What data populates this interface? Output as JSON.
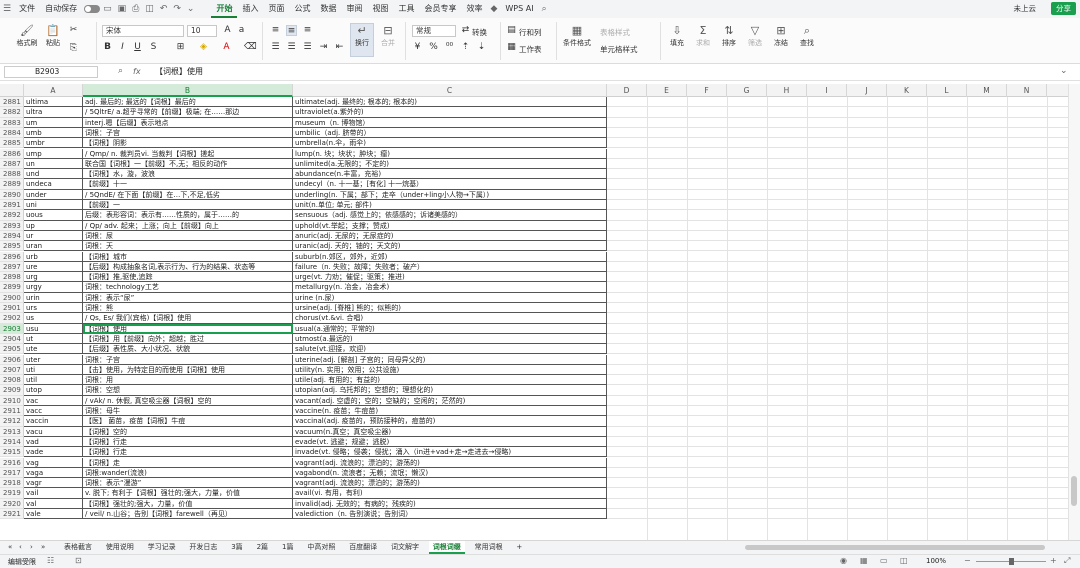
{
  "menu": {
    "file": "文件",
    "autosave": "自动保存",
    "tabs": [
      "开始",
      "插入",
      "页面",
      "公式",
      "数据",
      "审阅",
      "视图",
      "工具",
      "会员专享",
      "效率"
    ],
    "active_tab": "开始",
    "wps_ai": "WPS AI",
    "cloud": "未上云",
    "share": "分享"
  },
  "ribbon": {
    "format_painter": "格式刷",
    "paste": "粘贴",
    "font": "宋体",
    "font_size": "10",
    "wrap": "换行",
    "merge": "合并",
    "number_format": "常规",
    "convert": "转换",
    "rows_cols": "行和列",
    "worksheet": "工作表",
    "cond_format": "条件格式",
    "cell_style": "单元格样式",
    "table_style": "表格样式",
    "fill": "填充",
    "sum": "求和",
    "sort": "排序",
    "filter": "筛选",
    "freeze": "冻结",
    "find": "查找"
  },
  "formula_bar": {
    "cell_ref": "B2903",
    "fx": "fx",
    "content": "【词根】使用"
  },
  "columns": [
    "A",
    "B",
    "C",
    "D",
    "E",
    "F",
    "G",
    "H",
    "I",
    "J",
    "K",
    "L",
    "M",
    "N"
  ],
  "selected_column": "B",
  "selected_row": "2903",
  "rows": [
    [
      "2881",
      "ultima",
      "adj. 最后的; 最远的【词根】最后的",
      "ultimate(adj. 最终的; 根本的; 根本的)"
    ],
    [
      "2882",
      "ultra",
      "/ 5QltrE/  a.超乎寻常的【前缀】极端; 在……那边",
      "ultraviolet(a.紫外的)"
    ],
    [
      "2883",
      "um",
      "interj.嗯【后缀】表示地点",
      "museum（n. 博物馆）"
    ],
    [
      "2884",
      "umb",
      "词根：子宫",
      "umbilic（adj. 脐带的）"
    ],
    [
      "2885",
      "umbr",
      "【词根】阴影",
      "umbrella(n.伞，雨伞)"
    ],
    [
      "2886",
      "ump",
      "/ Qmp/ n. 裁判员vi. 当裁判【词根】搓起",
      "lump(n. 块；块状；肿块；瘤)"
    ],
    [
      "2887",
      "un",
      "联合国【词根】一【前缀】不,无；相反的动作",
      "unlimited(a.无限的；不定的)"
    ],
    [
      "2888",
      "und",
      "【词根】水，漩，波浪",
      "abundance(n.丰富，充裕)"
    ],
    [
      "2889",
      "undeca",
      "【前缀】十一",
      "undecyl（n. 十一基；[有化] 十一烷基）"
    ],
    [
      "2890",
      "under",
      "/ 5QndE/  在下面【前缀】在…下,不足,低劣",
      "underling(n. 下属；部下；走卒（under+ling小人物→下属）)"
    ],
    [
      "2891",
      "uni",
      "【前缀】一",
      "unit(n.单位; 单元; 部件)"
    ],
    [
      "2892",
      "uous",
      "后缀：表形容词：表示有……性质的，属于……的",
      "sensuous（adj. 感觉上的；依感感的；诉诸美感的）"
    ],
    [
      "2893",
      "up",
      "/ Qp/  adv. 起来；上涨；向上【前缀】向上",
      "uphold(vt.举起；支撑；赞成)"
    ],
    [
      "2894",
      "ur",
      "词根：尿",
      "anuric(adj. 无尿的；无尿症的)"
    ],
    [
      "2895",
      "uran",
      "词根：天",
      "uranic(adj. 天的；铀的；天文的)"
    ],
    [
      "2896",
      "urb",
      "【词根】城市",
      "suburb(n.郊区，郊外，近郊)"
    ],
    [
      "2897",
      "ure",
      "【后缀】构成抽象名词,表示行为、行为的结果、状态等",
      "failure（n. 失败；故障；失败者；破产）"
    ],
    [
      "2898",
      "urg",
      "【词根】推,驱使,追踪",
      "urge(vt. 力劝；催促；驱策；推进)"
    ],
    [
      "2899",
      "urgy",
      "词根：technology工艺",
      "metallurgy(n. 冶金，冶金术)"
    ],
    [
      "2900",
      "urin",
      "词根：表示“尿”",
      "urine (n.尿)"
    ],
    [
      "2901",
      "urs",
      "词根：熊",
      "ursine(adj. [脊椎] 熊的；似熊的)"
    ],
    [
      "2902",
      "us",
      "/ Qs, Es/  我们(宾格)【词根】使用",
      "chorus(vt.&vi. 合唱)"
    ],
    [
      "2903",
      "usu",
      "【词根】使用",
      "usual(a.通常的；平常的)"
    ],
    [
      "2904",
      "ut",
      "【词根】用【前缀】向外；超越；胜过",
      "utmost(a.最远的)"
    ],
    [
      "2905",
      "ute",
      "【后缀】表性质、大小状况、状貌",
      "salute(vt.迎接，欢迎)"
    ],
    [
      "2906",
      "uter",
      "词根：子宫",
      "uterine(adj. [解剖] 子宫的；同母异父的)"
    ],
    [
      "2907",
      "uti",
      "【击】使用，为特定目的而使用【词根】使用",
      "utility(n. 实用；效用；公共设施)"
    ],
    [
      "2908",
      "util",
      "词根：用",
      "utile(adj. 有用的；有益的)"
    ],
    [
      "2909",
      "utop",
      "词根：空想",
      "utopian(adj. 乌托邦的；空想的；理想化的)"
    ],
    [
      "2910",
      "vac",
      "/ vAk/ n. 休假, 真空吸尘器【词根】空的",
      "vacant(adj. 空虚的；空的；空缺的；空闲的；茫然的)"
    ],
    [
      "2911",
      "vacc",
      "词根：母牛",
      "vaccine(n. 疫苗；牛痘苗)"
    ],
    [
      "2912",
      "vaccin",
      "【医】 菌苗，疫苗【词根】牛痘",
      "vaccinal(adj. 疫苗的，预防接种的，痘苗的)"
    ],
    [
      "2913",
      "vacu",
      "【词根】空的",
      "vacuum(n.真空；真空吸尘器)"
    ],
    [
      "2914",
      "vad",
      "【词根】行走",
      "evade(vt. 逃避；规避；逃脱)"
    ],
    [
      "2915",
      "vade",
      "【词根】行走",
      "invade(vt. 侵略；侵袭；侵扰；涌入（in进+vad+走→走进去→侵略)"
    ],
    [
      "2916",
      "vag",
      "【词根】走",
      "vagrant(adj. 流浪的；漂泊的；游荡的)"
    ],
    [
      "2917",
      "vaga",
      "词根:wander(流浪)",
      "vagabond(n. 流浪者；无赖；流氓；懒汉)"
    ],
    [
      "2918",
      "vagr",
      "词根：表示“漫游”",
      "vagrant(adj. 流浪的；漂泊的；游荡的)"
    ],
    [
      "2919",
      "vail",
      "v. 脱下; 有利于【词根】强壮的;强大，力量，价值",
      "avail(vi. 有用，有利)"
    ],
    [
      "2920",
      "val",
      "【词根】强壮的;强大，力量，价值",
      "invalid(adj. 无效的；有病的；残疾的)"
    ],
    [
      "2921",
      "vale",
      "/ veil/  n.山谷；告别【词根】farewell（再见）",
      "valediction（n. 告别演说；告别词）"
    ]
  ],
  "sheet_tabs": [
    "表格截言",
    "使用说明",
    "学习记录",
    "开发日志",
    "3篇",
    "2篇",
    "1篇",
    "中高对照",
    "百度翻译",
    "词文解字",
    "词根词缀",
    "常用词根"
  ],
  "active_sheet": "词根词缀",
  "status": {
    "mode": "编辑受限",
    "zoom": "100%"
  },
  "colors": {
    "accent": "#1a9f4f",
    "accent_text": "#1a7f37",
    "selection_bg": "#d5ebd9"
  }
}
